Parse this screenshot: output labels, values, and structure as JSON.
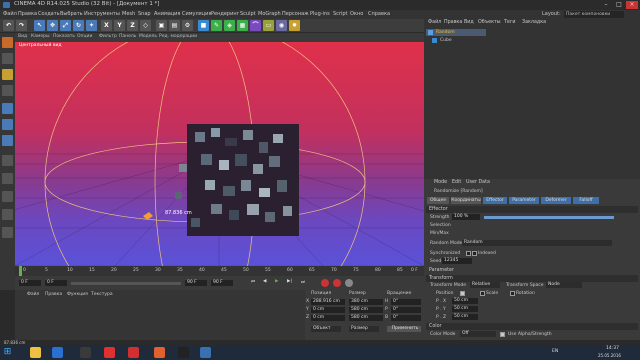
{
  "window": {
    "title": "CINEMA 4D R14.025 Studio (32 Bit) - [Документ 1 *]"
  },
  "menu": {
    "items": [
      "Файл",
      "Правка",
      "Создать",
      "Выбрать",
      "Инструменты",
      "Mesh",
      "Snap",
      "Анимация",
      "Симуляция",
      "Рендеринг",
      "Sculpt",
      "MoGraph",
      "Персонаж",
      "Plug-ins",
      "Script",
      "Окно",
      "Справка"
    ],
    "layout_label": "Layout:",
    "layout_value": "Пакет компоновки"
  },
  "viewport": {
    "menu": [
      "Вид",
      "Камеры",
      "Показать",
      "Опции",
      "Фильтр",
      "Панель",
      "Модель",
      "Ред. модерации"
    ],
    "label": "Центральный вид",
    "readout": "87.836 cm"
  },
  "timeline": {
    "ticks": [
      "0",
      "5",
      "10",
      "15",
      "20",
      "25",
      "30",
      "35",
      "40",
      "45",
      "50",
      "55",
      "60",
      "65",
      "70",
      "75",
      "80",
      "85",
      "90"
    ],
    "frame_end": "0 F"
  },
  "transport": {
    "start": "0 F",
    "current": "0 F",
    "end": "90 F",
    "end2": "90 F"
  },
  "material": {
    "menu": [
      "Файл",
      "Правка",
      "Функция",
      "Текстура"
    ]
  },
  "coords": {
    "headers": [
      "Позиция",
      "Размер",
      "Вращение"
    ],
    "rows": [
      {
        "axis": "X",
        "pos": "288.916 cm",
        "size": "380 cm",
        "rot_axis": "H",
        "rot": "0°"
      },
      {
        "axis": "Y",
        "pos": "0 cm",
        "size": "580 cm",
        "rot_axis": "P",
        "rot": "0°"
      },
      {
        "axis": "Z",
        "pos": "0 cm",
        "size": "580 cm",
        "rot_axis": "B",
        "rot": "0°"
      }
    ],
    "mode": "Объект",
    "mode2": "Размер",
    "apply": "Применить"
  },
  "object_manager": {
    "menu": [
      "Файл",
      "Правка",
      "Вид",
      "Объекты",
      "Теги",
      "Закладка"
    ],
    "objects": [
      {
        "name": "Random"
      },
      {
        "name": "Cube"
      }
    ]
  },
  "attributes": {
    "menu": [
      "Mode",
      "Edit",
      "User Data"
    ],
    "object_label": "Randomize [Random]",
    "tabs": [
      "Общее",
      "Координаты",
      "Effector",
      "Parameter",
      "Deformer",
      "Falloff"
    ],
    "section_effector": "Effector",
    "strength_label": "Strength",
    "strength_value": "100 %",
    "selection_label": "Selection",
    "minmax_label": "Min/Max",
    "random_mode_label": "Random Mode",
    "random_mode_value": "Random",
    "synchronized_label": "Synchronized",
    "indexed_label": "Indexed",
    "seed_label": "Seed",
    "seed_value": "12345",
    "section_parameter": "Parameter",
    "transform_label": "Transform",
    "transform_mode_label": "Transform Mode",
    "transform_mode_value": "Relative",
    "transform_space_label": "Transform Space",
    "transform_space_value": "Node",
    "position_label": "Position",
    "scale_label": "Scale",
    "rotation_label": "Rotation",
    "px": "50 cm",
    "py": "50 cm",
    "pz": "50 cm",
    "color_section": "Color",
    "color_mode_label": "Color Mode",
    "color_mode_value": "Off",
    "alpha_label": "Use Alpha/Strength"
  },
  "status": {
    "text": "87.836 cm"
  },
  "taskbar": {
    "lang": "EN",
    "time": "14:37",
    "date": "25.05.2016"
  }
}
